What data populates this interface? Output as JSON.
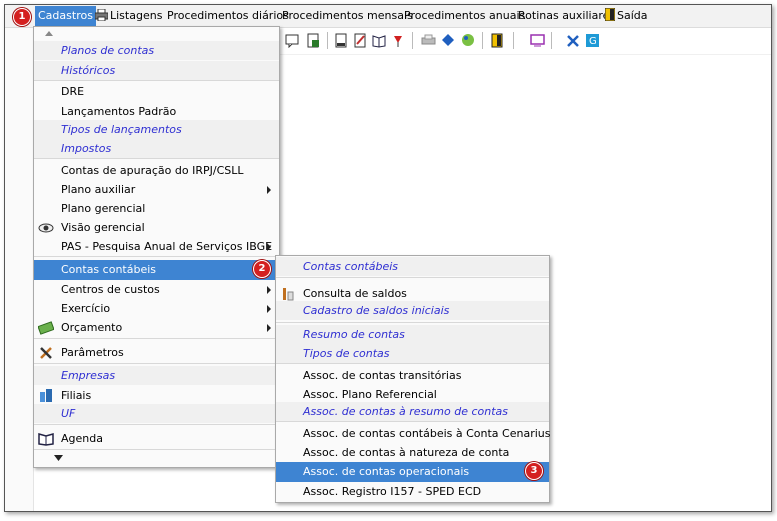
{
  "menubar": {
    "items": [
      "Cadastros",
      "Listagens",
      "Procedimentos diários",
      "Procedimentos mensais",
      "Procedimentos anuais",
      "Rotinas auxiliares",
      "Saída"
    ]
  },
  "cadastros_menu": {
    "items": [
      "Planos de contas",
      "Históricos",
      "DRE",
      "Lançamentos Padrão",
      "Tipos de lançamentos",
      "Impostos",
      "Contas de apuração do IRPJ/CSLL",
      "Plano auxiliar",
      "Plano gerencial",
      "Visão gerencial",
      "PAS - Pesquisa Anual de Serviços IBGE",
      "Contas contábeis",
      "Centros de custos",
      "Exercício",
      "Orçamento",
      "Parâmetros",
      "Empresas",
      "Filiais",
      "UF",
      "Agenda"
    ]
  },
  "contas_submenu": {
    "items": [
      "Contas contábeis",
      "Consulta de saldos",
      "Cadastro de saldos iniciais",
      "Resumo de contas",
      "Tipos de contas",
      "Assoc. de contas transitórias",
      "Assoc. Plano Referencial",
      "Assoc. de contas à resumo de contas",
      "Assoc. de contas contábeis à Conta Cenarius",
      "Assoc. de contas à natureza de conta",
      "Assoc. de contas operacionais",
      "Assoc. Registro I157 - SPED ECD"
    ]
  },
  "steps": [
    "1",
    "2",
    "3"
  ],
  "colors": {
    "highlight": "#3e84d2",
    "italic_text": "#2f2fd2",
    "step_badge": "#d42020"
  }
}
